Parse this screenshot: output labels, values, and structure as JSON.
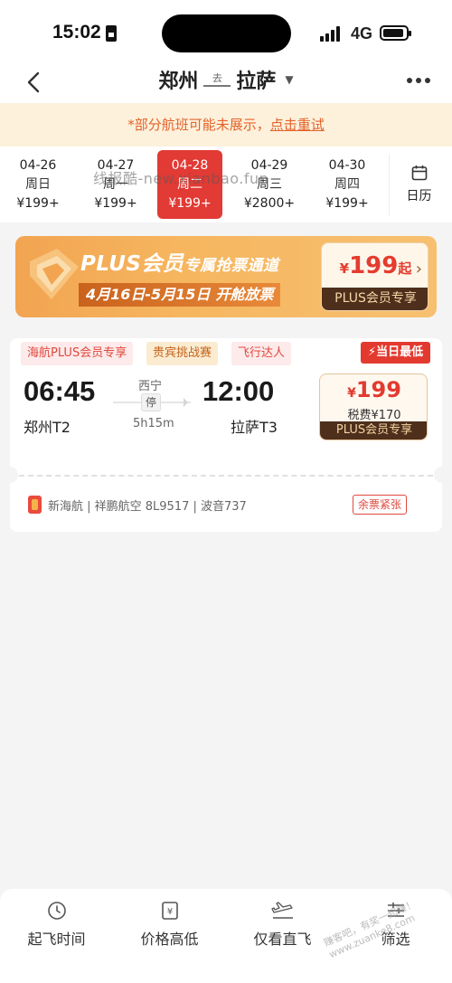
{
  "status": {
    "time": "15:02",
    "network": "4G"
  },
  "header": {
    "from": "郑州",
    "direction": "去",
    "to": "拉萨"
  },
  "notice": {
    "prefix": "*部分航班可能未展示，",
    "link": "点击重试"
  },
  "dates": [
    {
      "date": "04-26",
      "weekday": "周日",
      "price": "¥199+"
    },
    {
      "date": "04-27",
      "weekday": "周一",
      "price": "¥199+"
    },
    {
      "date": "04-28",
      "weekday": "周二",
      "price": "¥199+"
    },
    {
      "date": "04-29",
      "weekday": "周三",
      "price": "¥2800+"
    },
    {
      "date": "04-30",
      "weekday": "周四",
      "price": "¥199+"
    }
  ],
  "calendar_label": "日历",
  "watermark": "线报酷-new.xianbao.fun",
  "banner": {
    "title_a": "PLUS会员",
    "title_b": "专属抢票通道",
    "period": "4月16日-5月15日",
    "period_tail": "开舱放票",
    "price_prefix": "¥",
    "price": "199",
    "price_suffix": "起",
    "tag": "PLUS会员专享"
  },
  "flight": {
    "tags": [
      "海航PLUS会员专享",
      "贵宾挑战赛",
      "飞行达人"
    ],
    "best_badge": "当日最低",
    "dep_time": "06:45",
    "dep_airport": "郑州T2",
    "stop_city": "西宁",
    "stop_label": "停",
    "duration": "5h15m",
    "arr_time": "12:00",
    "arr_airport": "拉萨T3",
    "price_symbol": "¥",
    "price": "199",
    "tax": "税费¥170",
    "price_tag": "PLUS会员专享",
    "airline_info": "新海航 | 祥鹏航空 8L9517  |  波音737",
    "seat_badge": "余票紧张"
  },
  "bottom_tabs": [
    "起飞时间",
    "价格高低",
    "仅看直飞",
    "筛选"
  ],
  "watermark_corner": "赚客吧，有奖一起赚！www.zuanke8.com"
}
